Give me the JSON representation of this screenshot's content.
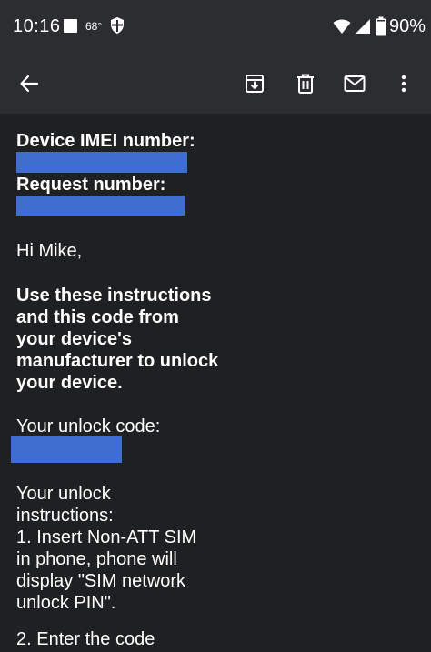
{
  "status_bar": {
    "time": "10:16",
    "temperature": "68°",
    "battery": "90%",
    "icons": [
      "notification-square-icon",
      "shield-icon",
      "wifi-icon",
      "signal-icon",
      "battery-icon"
    ]
  },
  "toolbar": {
    "icons": [
      "back-arrow-icon",
      "archive-icon",
      "delete-icon",
      "mark-unread-icon",
      "more-vert-icon"
    ]
  },
  "email": {
    "imei_label": "Device IMEI number:",
    "request_label": "Request number:",
    "greeting": "Hi Mike,",
    "intro_lines": [
      "Use these instructions",
      "and this code from",
      "your device's",
      "manufacturer to unlock",
      "your device."
    ],
    "unlock_code_label": "Your unlock code:",
    "instructions_lines": [
      "Your unlock",
      "instructions:",
      "1. Insert Non-ATT SIM",
      "in phone, phone will",
      "display \"SIM network",
      "unlock PIN\"."
    ],
    "step2": "2. Enter the code"
  },
  "colors": {
    "background": "#1f2022",
    "bar": "#2c2d30",
    "redaction": "#3e6fd0",
    "text": "#ffffff"
  }
}
